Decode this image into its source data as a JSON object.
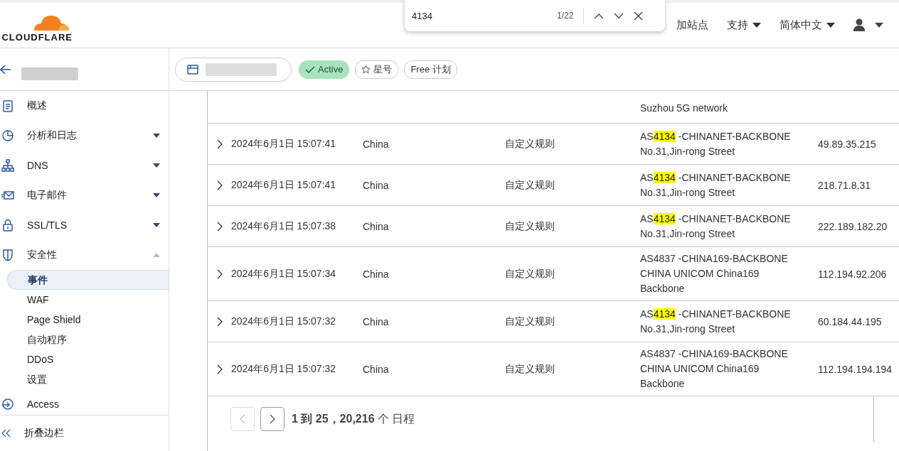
{
  "header": {
    "logo": "CLOUDFLARE",
    "nav": [
      {
        "label": "加站点",
        "kind": "link"
      },
      {
        "label": "支持",
        "kind": "menu"
      },
      {
        "label": "简体中文",
        "kind": "menu"
      },
      {
        "kind": "user"
      }
    ]
  },
  "find_bar": {
    "value": "4134",
    "count": "1/22"
  },
  "site_bar": {
    "badges": [
      {
        "label": "Active",
        "kind": "status"
      },
      {
        "label": "星号",
        "kind": "star"
      },
      {
        "label": "Free 计划",
        "kind": "plan"
      }
    ]
  },
  "sidebar": {
    "items": [
      {
        "label": "概述",
        "kind": "clipboard"
      },
      {
        "label": "分析和日志",
        "kind": "chart",
        "expanded": false
      },
      {
        "label": "DNS",
        "kind": "network",
        "expanded": false
      },
      {
        "label": "电子邮件",
        "kind": "mail",
        "expanded": false
      },
      {
        "label": "SSL/TLS",
        "kind": "lock",
        "expanded": false
      },
      {
        "label": "安全性",
        "kind": "shield",
        "expanded": true,
        "children": [
          {
            "label": "事件",
            "selected": true
          },
          {
            "label": "WAF",
            "selected": false
          },
          {
            "label": "Page Shield",
            "selected": false
          },
          {
            "label": "自动程序",
            "selected": false
          },
          {
            "label": "DDoS",
            "selected": false
          },
          {
            "label": "设置",
            "selected": false
          }
        ]
      },
      {
        "label": "Access",
        "kind": "access"
      }
    ],
    "collapse": "折叠边栏"
  },
  "table": {
    "partial_row": {
      "asn_lines": [
        "Suzhou 5G network"
      ]
    },
    "rows": [
      {
        "date": "2024年6月1日 15:07:41",
        "country": "China",
        "action": "自定义规则",
        "asn": [
          [
            {
              "t": "AS"
            },
            {
              "t": "4134",
              "highlight": true
            },
            {
              "t": " -CHINANET-BACKBONE"
            }
          ],
          [
            {
              "t": "No.31,Jin-rong Street"
            }
          ]
        ],
        "ip": "49.89.35.215"
      },
      {
        "date": "2024年6月1日 15:07:41",
        "country": "China",
        "action": "自定义规则",
        "asn": [
          [
            {
              "t": "AS"
            },
            {
              "t": "4134",
              "highlight": true
            },
            {
              "t": " -CHINANET-BACKBONE"
            }
          ],
          [
            {
              "t": "No.31,Jin-rong Street"
            }
          ]
        ],
        "ip": "218.71.8.31"
      },
      {
        "date": "2024年6月1日 15:07:38",
        "country": "China",
        "action": "自定义规则",
        "asn": [
          [
            {
              "t": "AS"
            },
            {
              "t": "4134",
              "highlight": true
            },
            {
              "t": " -CHINANET-BACKBONE"
            }
          ],
          [
            {
              "t": "No.31,Jin-rong Street"
            }
          ]
        ],
        "ip": "222.189.182.20"
      },
      {
        "date": "2024年6月1日 15:07:34",
        "country": "China",
        "action": "自定义规则",
        "asn": [
          [
            {
              "t": "AS4837 -CHINA169-BACKBONE"
            }
          ],
          [
            {
              "t": "CHINA UNICOM China169"
            }
          ],
          [
            {
              "t": "Backbone"
            }
          ]
        ],
        "ip": "112.194.92.206"
      },
      {
        "date": "2024年6月1日 15:07:32",
        "country": "China",
        "action": "自定义规则",
        "asn": [
          [
            {
              "t": "AS"
            },
            {
              "t": "4134",
              "highlight": true
            },
            {
              "t": " -CHINANET-BACKBONE"
            }
          ],
          [
            {
              "t": "No.31,Jin-rong Street"
            }
          ]
        ],
        "ip": "60.184.44.195"
      },
      {
        "date": "2024年6月1日 15:07:32",
        "country": "China",
        "action": "自定义规则",
        "asn": [
          [
            {
              "t": "AS4837 -CHINA169-BACKBONE"
            }
          ],
          [
            {
              "t": "CHINA UNICOM China169"
            }
          ],
          [
            {
              "t": "Backbone"
            }
          ]
        ],
        "ip": "112.194.194.194"
      }
    ],
    "pagination": {
      "prev_disabled": true,
      "summary": "**1 到 25，20,216** 个 日程"
    }
  }
}
